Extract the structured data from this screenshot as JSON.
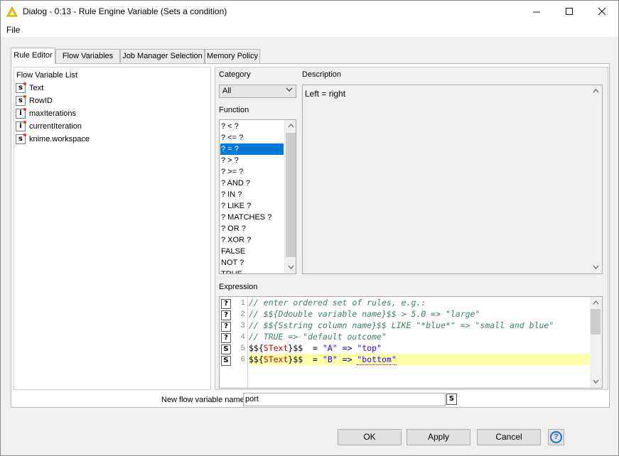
{
  "window": {
    "title": "Dialog - 0:13 - Rule Engine Variable (Sets a condition)",
    "menu": [
      "File"
    ]
  },
  "tabs": [
    "Rule Editor",
    "Flow Variables",
    "Job Manager Selection",
    "Memory Policy"
  ],
  "flow_variable_list": {
    "label": "Flow Variable List",
    "items": [
      {
        "type": "s",
        "name": "Text"
      },
      {
        "type": "s",
        "name": "RowID"
      },
      {
        "type": "i",
        "name": "maxIterations"
      },
      {
        "type": "i",
        "name": "currentIteration"
      },
      {
        "type": "s",
        "name": "knime.workspace"
      }
    ]
  },
  "category": {
    "label": "Category",
    "selected": "All"
  },
  "function": {
    "label": "Function",
    "items": [
      "? < ?",
      "? <= ?",
      "? = ?",
      "? > ?",
      "? >= ?",
      "? AND ?",
      "? IN ?",
      "? LIKE ?",
      "? MATCHES ?",
      "? OR ?",
      "? XOR ?",
      "FALSE",
      "NOT ?",
      "TRUE"
    ],
    "selected": "? = ?"
  },
  "description": {
    "label": "Description",
    "text": "Left = right"
  },
  "expression": {
    "label": "Expression",
    "line_numbers": [
      "1",
      "2",
      "3",
      "4",
      "5",
      "6"
    ],
    "gutter_icons": [
      "?",
      "?",
      "?",
      "?",
      "S",
      "S"
    ],
    "lines": {
      "l1": "// enter ordered set of rules, e.g.:",
      "l2": "// $${Ddouble variable name}$$ > 5.0 => \"large\"",
      "l3": "// $${Sstring column name}$$ LIKE \"*blue*\" => \"small and blue\"",
      "l4": "// TRUE => \"default outcome\"",
      "l5": {
        "open": "$${",
        "var": "SText",
        "close": "}$$",
        "eq": "  = ",
        "lit": "\"A\"",
        "arrow": " => ",
        "result": "\"top\""
      },
      "l6": {
        "open": "$${",
        "var": "SText",
        "close": "}$$",
        "eq": "  = ",
        "lit": "\"B\"",
        "arrow": " => ",
        "result": "\"bottom\""
      }
    }
  },
  "new_flow_variable": {
    "label": "New flow variable name",
    "value": "port",
    "type_badge": "S"
  },
  "buttons": {
    "ok": "OK",
    "apply": "Apply",
    "cancel": "Cancel",
    "help": "?"
  },
  "colors": {
    "selection": "#0078d7",
    "comment": "#3f7f5f",
    "string": "#2a00ff",
    "highlight_line": "#ffffaa",
    "title_icon": "#f0c020"
  }
}
